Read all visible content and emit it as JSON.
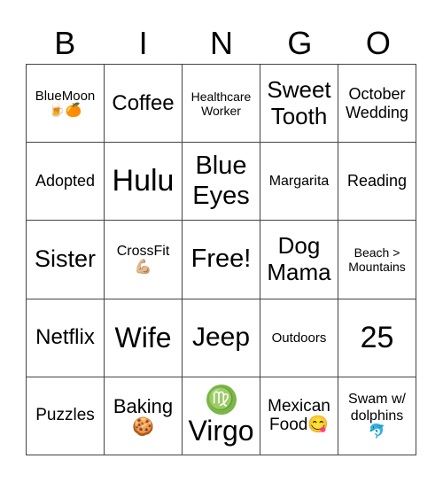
{
  "header": [
    "B",
    "I",
    "N",
    "G",
    "O"
  ],
  "cells": [
    {
      "text": "BlueMoon",
      "emoji": "🍺🍊",
      "size": 15
    },
    {
      "text": "Coffee",
      "emoji": "",
      "size": 24
    },
    {
      "text": "Healthcare\nWorker",
      "emoji": "",
      "size": 14
    },
    {
      "text": "Sweet\nTooth",
      "emoji": "",
      "size": 26
    },
    {
      "text": "October\nWedding",
      "emoji": "",
      "size": 18
    },
    {
      "text": "Adopted",
      "emoji": "",
      "size": 18
    },
    {
      "text": "Hulu",
      "emoji": "",
      "size": 34
    },
    {
      "text": "Blue\nEyes",
      "emoji": "",
      "size": 29
    },
    {
      "text": "Margarita",
      "emoji": "",
      "size": 16
    },
    {
      "text": "Reading\n ",
      "emoji": "",
      "size": 18
    },
    {
      "text": "Sister",
      "emoji": "",
      "size": 27
    },
    {
      "text": "CrossFit",
      "emoji": "💪🏼",
      "size": 16
    },
    {
      "text": "Free!",
      "emoji": "",
      "size": 29
    },
    {
      "text": "Dog\nMama",
      "emoji": "",
      "size": 26
    },
    {
      "text": "Beach >\nMountains",
      "emoji": "",
      "size": 14
    },
    {
      "text": "Netflix",
      "emoji": "",
      "size": 24
    },
    {
      "text": "Wife",
      "emoji": "",
      "size": 32
    },
    {
      "text": "Jeep",
      "emoji": "",
      "size": 30
    },
    {
      "text": "Outdoors",
      "emoji": "",
      "size": 15
    },
    {
      "text": "25",
      "emoji": "",
      "size": 34
    },
    {
      "text": "Puzzles",
      "emoji": "",
      "size": 19
    },
    {
      "text": "Baking",
      "emoji": "🍪",
      "size": 22
    },
    {
      "text": "Virgo",
      "emoji": "♍",
      "size": 32,
      "emoji_first": true
    },
    {
      "text": "Mexican\nFood😋",
      "emoji": "",
      "size": 19
    },
    {
      "text": "Swam w/\ndolphins",
      "emoji": "🐬",
      "size": 16
    }
  ]
}
